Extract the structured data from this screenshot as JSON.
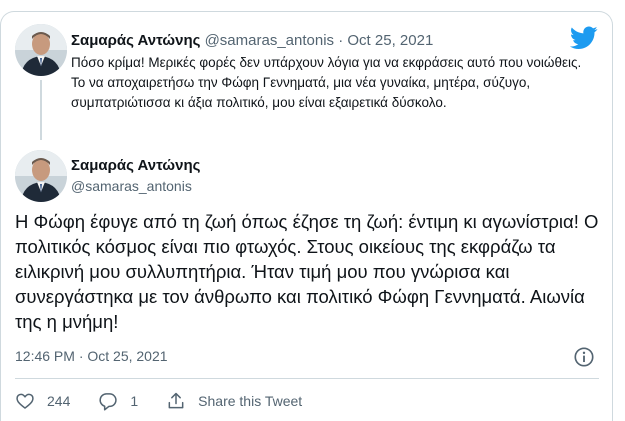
{
  "parent_tweet": {
    "name": "Σαμαράς Αντώνης",
    "handle": "@samaras_antonis",
    "separator": "·",
    "date": "Oct 25, 2021",
    "text": "Πόσο κρίμα! Μερικές φορές δεν υπάρχουν λόγια για να εκφράσεις αυτό που νοιώθεις. Το να αποχαιρετήσω την Φώφη Γεννηματά, μια νέα γυναίκα, μητέρα, σύζυγο, συμπατριώτισσα κι άξια πολιτικό, μου είναι εξαιρετικά δύσκολο."
  },
  "main_tweet": {
    "name": "Σαμαράς Αντώνης",
    "handle": "@samaras_antonis",
    "text": "Η Φώφη έφυγε από τη ζωή όπως έζησε τη ζωή: έντιμη κι αγωνίστρια! Ο πολιτικός κόσμος είναι πιο φτωχός. Στους οικείους της εκφράζω τα ειλικρινή μου συλλυπητήρια. Ήταν τιμή μου που γνώρισα και συνεργάστηκα με τον άνθρωπο και πολιτικό Φώφη Γεννηματά. Αιωνία της η μνήμη!",
    "timestamp": "12:46 PM · Oct 25, 2021"
  },
  "actions": {
    "likes": "244",
    "replies": "1",
    "share_label": "Share this Tweet"
  },
  "icons": {
    "logo": "twitter-bird-icon",
    "info": "info-icon",
    "like": "heart-icon",
    "reply": "reply-icon",
    "share": "share-icon"
  },
  "colors": {
    "brand": "#1d9bf0",
    "text": "#0f1419",
    "muted": "#536471",
    "border": "#cfd9de"
  }
}
